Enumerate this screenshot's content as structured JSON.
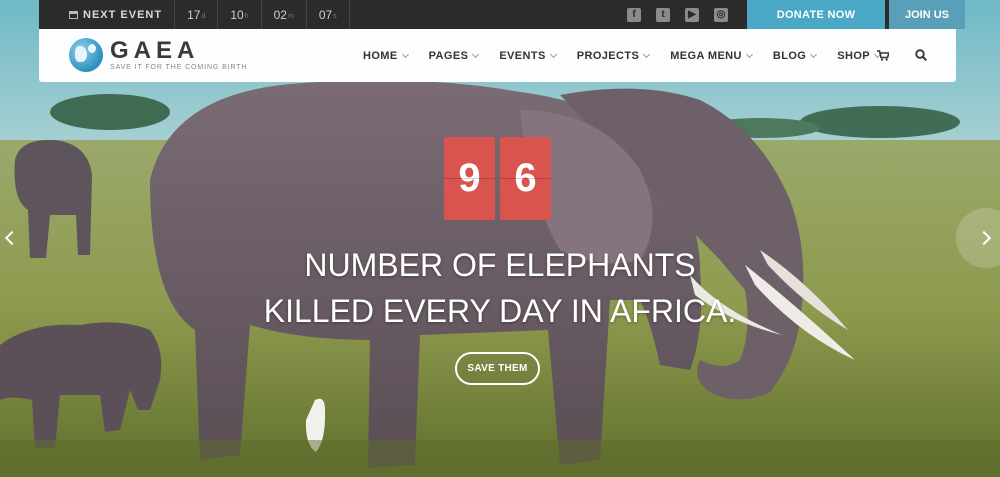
{
  "topbar": {
    "event_label": "NEXT EVENT",
    "countdown": [
      {
        "value": "17",
        "unit": "d"
      },
      {
        "value": "10",
        "unit": "h"
      },
      {
        "value": "02",
        "unit": "m"
      },
      {
        "value": "07",
        "unit": "s"
      }
    ],
    "socials": [
      "facebook-icon",
      "twitter-icon",
      "youtube-icon",
      "instagram-icon"
    ],
    "donate_label": "DONATE NOW",
    "join_label": "JOIN US"
  },
  "nav": {
    "logo_name": "GAEA",
    "logo_tagline": "SAVE IT FOR THE COMING BIRTH",
    "items": [
      {
        "label": "HOME"
      },
      {
        "label": "PAGES"
      },
      {
        "label": "EVENTS"
      },
      {
        "label": "PROJECTS"
      },
      {
        "label": "MEGA MENU"
      },
      {
        "label": "BLOG"
      },
      {
        "label": "SHOP"
      }
    ]
  },
  "hero": {
    "counter": [
      "9",
      "6"
    ],
    "headline_line1": "NUMBER OF ELEPHANTS",
    "headline_line2": "KILLED EVERY DAY IN AFRICA.",
    "cta_label": "SAVE THEM"
  },
  "colors": {
    "accent": "#4aa8c6",
    "counter_bg": "#d9534f",
    "topbar_bg": "#2b2b2b"
  }
}
